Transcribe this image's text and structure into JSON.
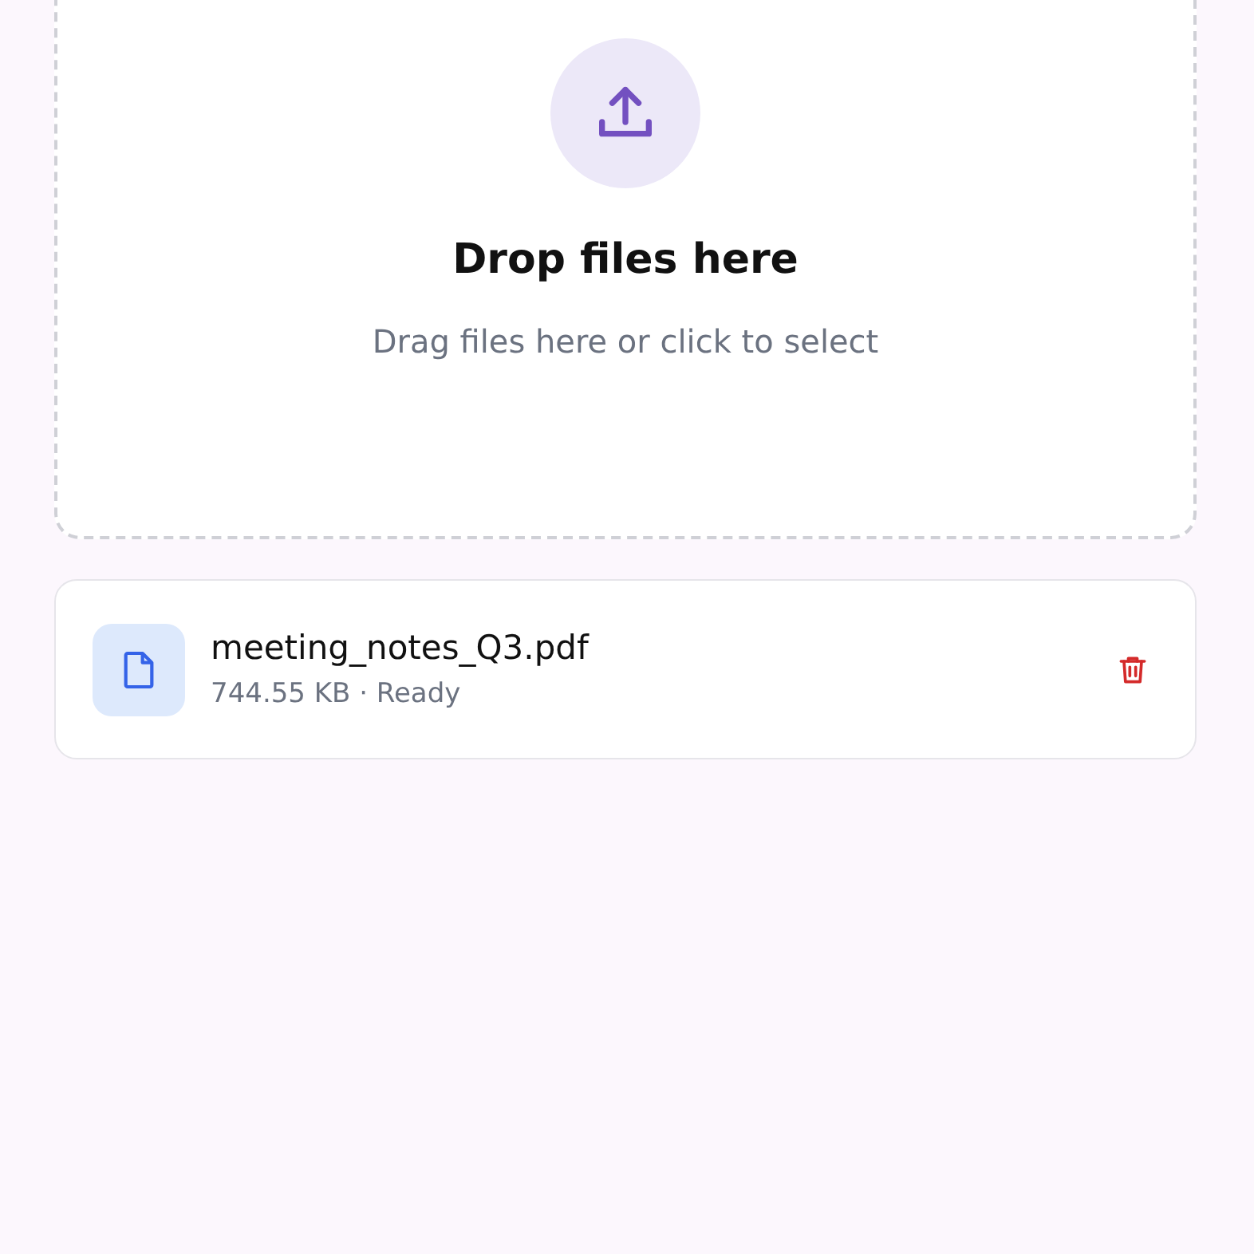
{
  "dropzone": {
    "title": "Drop files here",
    "subtitle": "Drag files here or click to select"
  },
  "files": [
    {
      "name": "meeting_notes_Q3.pdf",
      "meta": "744.55 KB · Ready"
    }
  ]
}
